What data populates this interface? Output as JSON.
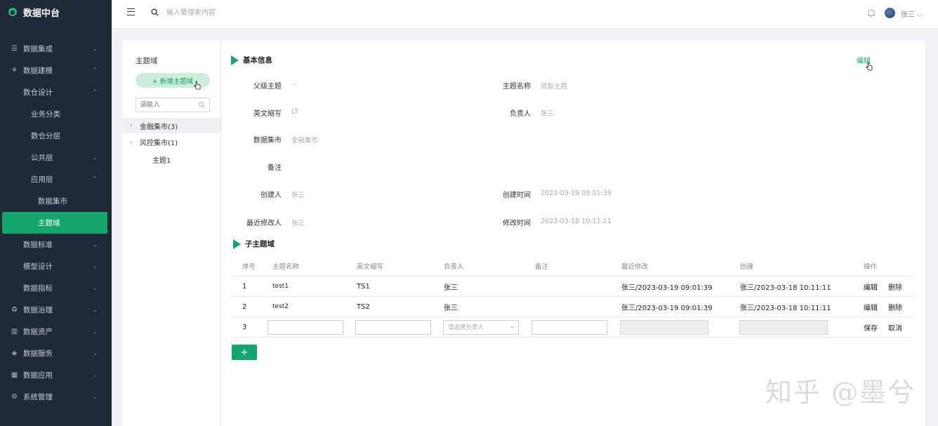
{
  "app": {
    "title": "数据中台"
  },
  "sidebar": {
    "items": [
      {
        "label": "数据集成",
        "level": 1,
        "icon": "database-icon",
        "chevron": "down"
      },
      {
        "label": "数据建模",
        "level": 1,
        "icon": "model-icon",
        "chevron": "up"
      },
      {
        "label": "数仓设计",
        "level": 2,
        "chevron": "up"
      },
      {
        "label": "业务分类",
        "level": 3
      },
      {
        "label": "数仓分层",
        "level": 3
      },
      {
        "label": "公共层",
        "level": 3,
        "chevron": "down"
      },
      {
        "label": "应用层",
        "level": 3,
        "chevron": "up"
      },
      {
        "label": "数据集市",
        "level": 4
      },
      {
        "label": "主题域",
        "level": 4,
        "active": true
      },
      {
        "label": "数据标准",
        "level": 2,
        "chevron": "down"
      },
      {
        "label": "模型设计",
        "level": 2,
        "chevron": "down"
      },
      {
        "label": "数据指标",
        "level": 2,
        "chevron": "down"
      },
      {
        "label": "数据治理",
        "level": 1,
        "icon": "recycle-icon",
        "chevron": "down"
      },
      {
        "label": "数据资产",
        "level": 1,
        "icon": "barcode-icon",
        "chevron": "down"
      },
      {
        "label": "数据服务",
        "level": 1,
        "icon": "cube-icon",
        "chevron": "down"
      },
      {
        "label": "数据应用",
        "level": 1,
        "icon": "grid-icon",
        "chevron": "down"
      },
      {
        "label": "系统管理",
        "level": 1,
        "icon": "gear-icon",
        "chevron": "down"
      }
    ]
  },
  "header": {
    "search_placeholder": "输入要搜索内容",
    "user": "张三"
  },
  "left_panel": {
    "title": "主题域",
    "add_button": "+ 新增主题域",
    "search_placeholder": "请输入",
    "tree": [
      {
        "label": "金融集市(3)",
        "arrow": "›",
        "selected": true
      },
      {
        "label": "风控集市(1)",
        "arrow": "⌄",
        "selected": false
      },
      {
        "label": "主题1",
        "child": true
      }
    ]
  },
  "basic_info": {
    "title": "基本信息",
    "edit": "编辑",
    "fields": {
      "parent": {
        "label": "父级主题",
        "value": "--"
      },
      "name": {
        "label": "主题名称",
        "value": "贷款主题"
      },
      "abbr": {
        "label": "英文缩写",
        "value": "LT"
      },
      "owner": {
        "label": "负责人",
        "value": "张三"
      },
      "mart": {
        "label": "数据集市",
        "value": "金融集市"
      },
      "remark": {
        "label": "备注",
        "value": ""
      },
      "creator": {
        "label": "创建人",
        "value": "张三"
      },
      "created": {
        "label": "创建时间",
        "value": "2023-03-19 09:01:39"
      },
      "modifier": {
        "label": "最近修改人",
        "value": "张三"
      },
      "modified": {
        "label": "修改时间",
        "value": "2023-03-18 10:11:11"
      }
    }
  },
  "sub_domains": {
    "title": "子主题域",
    "columns": [
      "序号",
      "主题名称",
      "英文缩写",
      "负责人",
      "备注",
      "最近修改",
      "创建",
      "操作"
    ],
    "rows": [
      {
        "no": "1",
        "name": "test1",
        "abbr": "TS1",
        "owner": "张三",
        "remark": "",
        "modified": "张三/2023-03-19 09:01:39",
        "created": "张三/2023-03-18 10:11:11",
        "a1": "编辑",
        "a2": "删除"
      },
      {
        "no": "2",
        "name": "test2",
        "abbr": "TS2",
        "owner": "张三",
        "remark": "",
        "modified": "张三/2023-03-19 09:01:39",
        "created": "张三/2023-03-18 10:11:11",
        "a1": "编辑",
        "a2": "删除"
      }
    ],
    "new_row": {
      "no": "3",
      "owner_placeholder": "请选择负责人",
      "save": "保存",
      "cancel": "取消"
    },
    "add": "+"
  },
  "watermark": "知乎 @墨兮"
}
